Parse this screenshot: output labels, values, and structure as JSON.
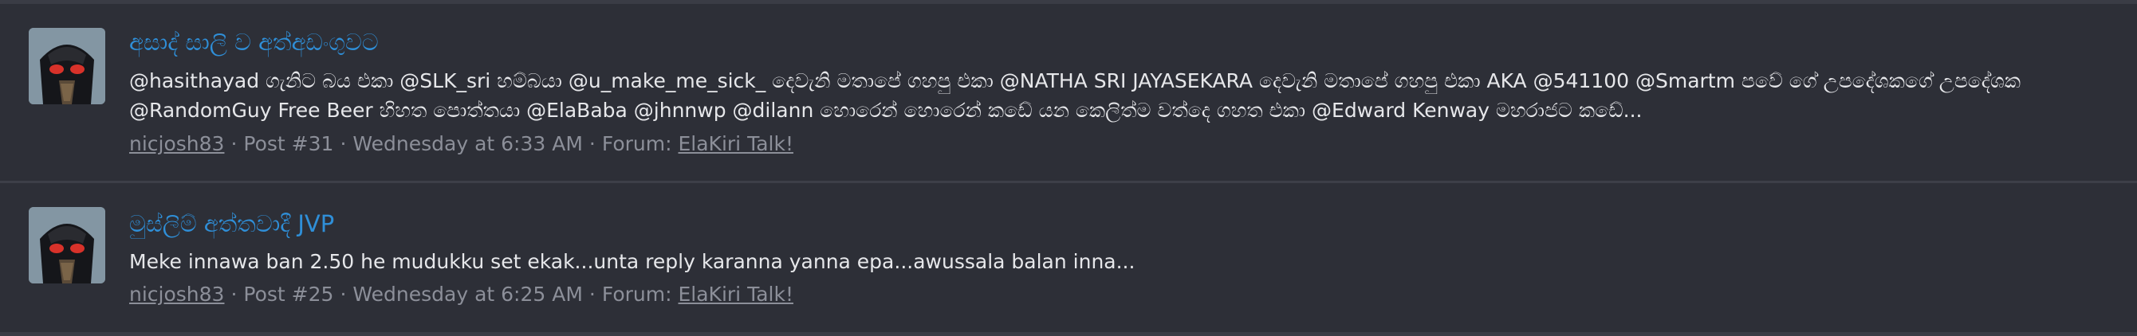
{
  "results": [
    {
      "title": "අසාද් සාලි ව අත්අඩංගුවට",
      "snippet_lines": [
        "@hasithayad ගැනිට බය එකා @SLK_sri හම්බයා @u_make_me_sick_ දෙවැනි මතාපේ ගහපු එකා @NATHA SRI JAYASEKARA දෙවැනි මතාපේ ගහපු එකා AKA @541100 @Smartm පවේ ගේ උපදේශකගේ උපදේශක",
        "@RandomGuy Free Beer හිහත පොත්තයා @ElaBaba @jhnnwp @dilann හොරෙන් හොරෙන් කඩේ යන කෙලිත්ම වත්දෙ ගහත එකා @Edward Kenway මහරාජට කඩේ..."
      ],
      "author": "nicjosh83",
      "post": "Post #31",
      "time": "Wednesday at 6:33 AM",
      "forum_label": "Forum:",
      "forum": "ElaKiri Talk!"
    },
    {
      "title": "මුස්ලිම් අත්තවාදී JVP",
      "snippet_lines": [
        "Meke innawa ban 2.50 he mudukku set ekak...unta reply karanna yanna epa...awussala balan inna..."
      ],
      "author": "nicjosh83",
      "post": "Post #25",
      "time": "Wednesday at 6:25 AM",
      "forum_label": "Forum:",
      "forum": "ElaKiri Talk!"
    }
  ],
  "separator": "·",
  "colors": {
    "background": "#2d2f37",
    "title": "#2f8fd8",
    "text": "#e6e7ea",
    "meta": "#8c8f99"
  }
}
